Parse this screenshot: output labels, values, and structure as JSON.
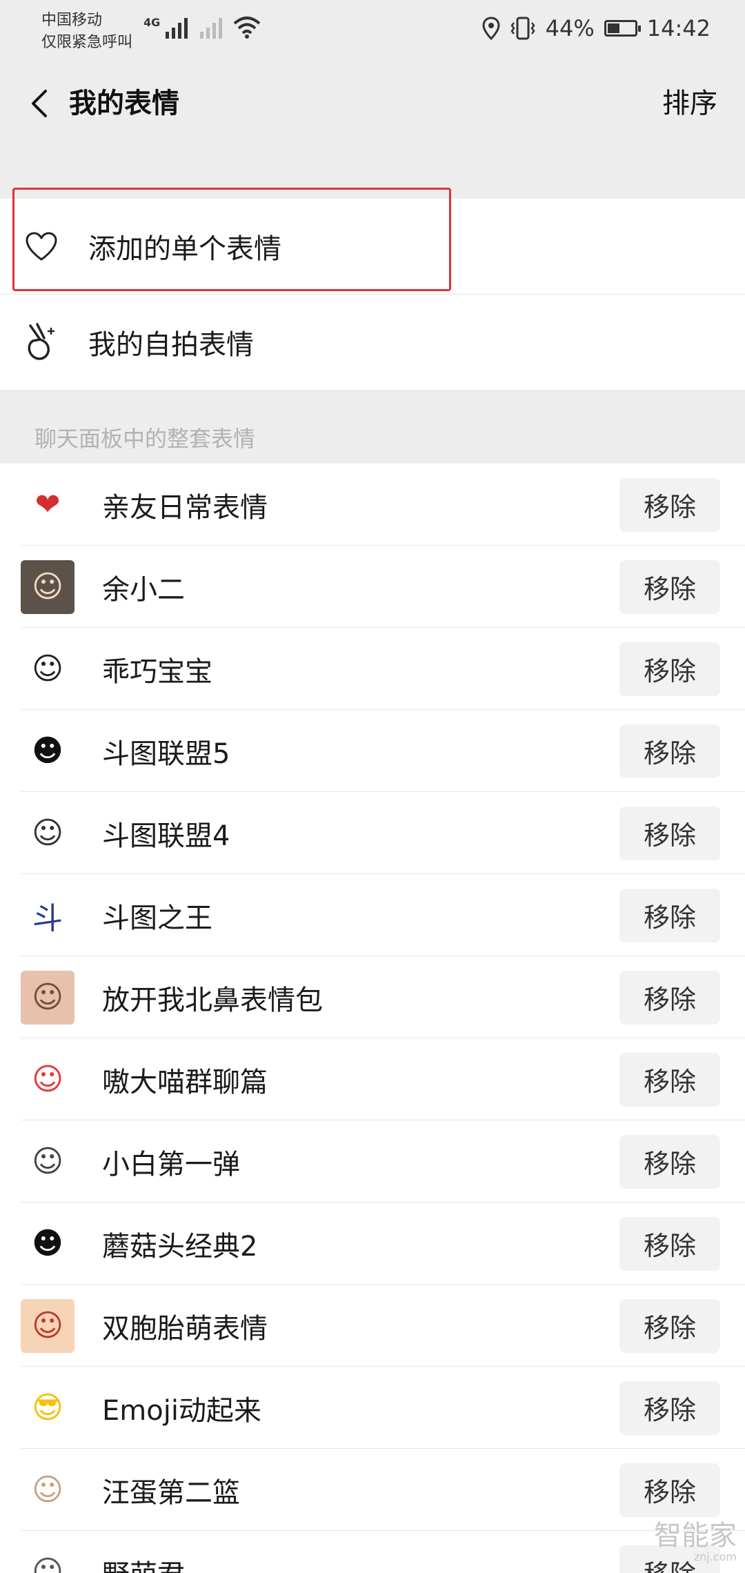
{
  "status_bar": {
    "carrier_line1": "中国移动",
    "carrier_line2": "仅限紧急呼叫",
    "network": "4G",
    "battery": "44%",
    "battery_level": 0.44,
    "time": "14:42"
  },
  "nav": {
    "back_icon": "chevron-left-icon",
    "title": "我的表情",
    "sort": "排序"
  },
  "menu": [
    {
      "label": "添加的单个表情",
      "icon": "heart-icon"
    },
    {
      "label": "我的自拍表情",
      "icon": "victory-hand-icon"
    }
  ],
  "highlight_color": "#e0313a",
  "section_header": "聊天面板中的整套表情",
  "remove_label": "移除",
  "stickers": [
    {
      "name": "亲友日常表情",
      "icon": "heart-sticker-icon",
      "glyph": "❤",
      "bg": "#ffffff",
      "color": "#d32f2f"
    },
    {
      "name": "余小二",
      "icon": "photo-face-icon",
      "glyph": "☺",
      "bg": "#5d5249",
      "color": "#f2d7c0"
    },
    {
      "name": "乖巧宝宝",
      "icon": "white-blob-icon",
      "glyph": "☺",
      "bg": "#ffffff",
      "color": "#222222"
    },
    {
      "name": "斗图联盟5",
      "icon": "meme-face-icon",
      "glyph": "☻",
      "bg": "#ffffff",
      "color": "#111111"
    },
    {
      "name": "斗图联盟4",
      "icon": "meme-face-icon",
      "glyph": "☺",
      "bg": "#ffffff",
      "color": "#333333"
    },
    {
      "name": "斗图之王",
      "icon": "text-logo-icon",
      "glyph": "斗",
      "bg": "#ffffff",
      "color": "#2b3a8c"
    },
    {
      "name": "放开我北鼻表情包",
      "icon": "baby-photo-icon",
      "glyph": "☺",
      "bg": "#e6c2ad",
      "color": "#7a4a3a"
    },
    {
      "name": "嗷大喵群聊篇",
      "icon": "cat-face-icon",
      "glyph": "☺",
      "bg": "#ffffff",
      "color": "#e53935"
    },
    {
      "name": "小白第一弹",
      "icon": "small-face-icon",
      "glyph": "☺",
      "bg": "#ffffff",
      "color": "#444444"
    },
    {
      "name": "蘑菇头经典2",
      "icon": "mushroom-head-icon",
      "glyph": "☻",
      "bg": "#ffffff",
      "color": "#111111"
    },
    {
      "name": "双胞胎萌表情",
      "icon": "twins-photo-icon",
      "glyph": "☺",
      "bg": "#f5d4b8",
      "color": "#c0392b"
    },
    {
      "name": "Emoji动起来",
      "icon": "sunglasses-emoji-icon",
      "glyph": "😎",
      "bg": "#ffffff",
      "color": "#f4c20d"
    },
    {
      "name": "汪蛋第二篮",
      "icon": "egg-face-icon",
      "glyph": "☺",
      "bg": "#ffffff",
      "color": "#c9a184"
    },
    {
      "name": "野萌君",
      "icon": "round-face-icon",
      "glyph": "☺",
      "bg": "#ffffff",
      "color": "#555555"
    }
  ],
  "watermark": {
    "main": "智能家",
    "sub": "znj.com"
  }
}
